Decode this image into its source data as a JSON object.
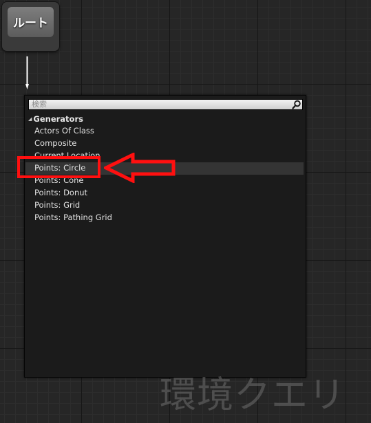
{
  "root_node": {
    "label": "ルート"
  },
  "search": {
    "placeholder": "検索"
  },
  "menu": {
    "category": "Generators",
    "items": [
      "Actors Of Class",
      "Composite",
      "Current Location",
      "Points: Circle",
      "Points: Cone",
      "Points: Donut",
      "Points: Grid",
      "Points: Pathing Grid"
    ],
    "selected_item": "Points: Circle"
  },
  "annotation": {
    "color": "#ff1010"
  },
  "watermark": {
    "text": "環境クエリ"
  },
  "icons": {
    "search": "magnifier-icon",
    "category_caret": "triangle-down-right-icon",
    "connector": "down-arrow-icon",
    "annotation_arrow": "left-arrow-icon"
  }
}
